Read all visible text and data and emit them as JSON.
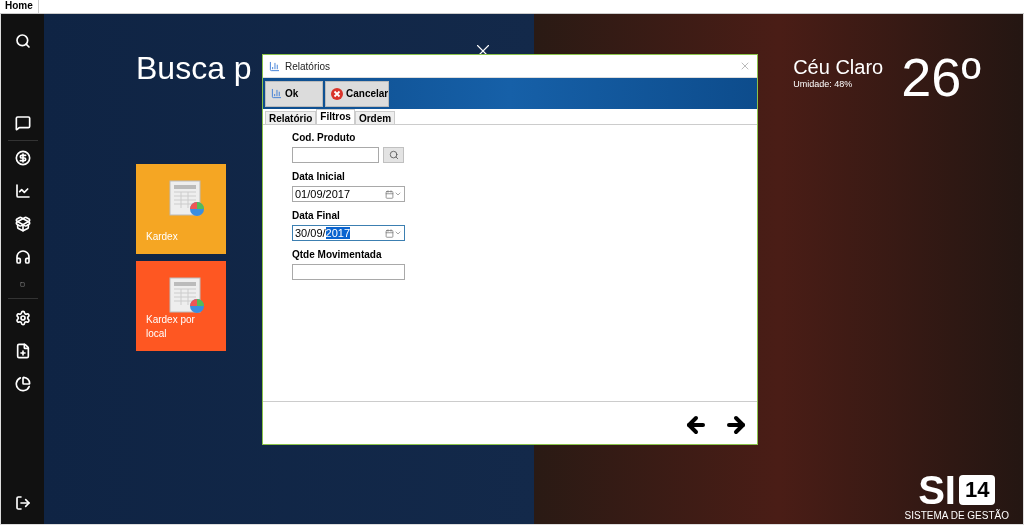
{
  "top_tabs": [
    {
      "label": "Home",
      "selected": true
    }
  ],
  "heading": "Busca p",
  "tiles": [
    {
      "label": "Kardex",
      "color": "#f5a623"
    },
    {
      "label": "Kardex por local",
      "color": "#fe5722"
    }
  ],
  "weather": {
    "condition": "Céu Claro",
    "humidity": "Umidade: 48%",
    "temperature": "26º"
  },
  "logo": {
    "mark": "SI",
    "badge": "14",
    "tagline": "SISTEMA DE GESTÃO"
  },
  "dialog": {
    "title": "Relatórios",
    "buttons": [
      {
        "label": "Ok",
        "kind": "report"
      },
      {
        "label": "Cancelar",
        "kind": "cancel"
      }
    ],
    "tabs": [
      {
        "label": "Relatório",
        "selected": false
      },
      {
        "label": "Filtros",
        "selected": true
      },
      {
        "label": "Ordem",
        "selected": false
      }
    ],
    "fields": [
      {
        "label": "Cod. Produto",
        "kind": "lookup"
      },
      {
        "label": "Data Inicial",
        "kind": "date",
        "value": "01/09/2017",
        "focused": false
      },
      {
        "label": "Data Final",
        "kind": "date",
        "value": "30/09/",
        "selection": "2017",
        "focused": true
      },
      {
        "label": "Qtde Movimentada",
        "kind": "text"
      }
    ]
  }
}
